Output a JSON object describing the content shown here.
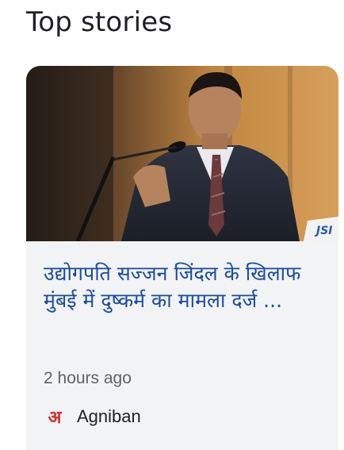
{
  "section": {
    "title": "Top stories"
  },
  "story": {
    "headline": "उद्योगपति सज्जन जिंदल के खिलाफ मुंबई में दुष्कर्म का मामला दर्ज ...",
    "time": "2 hours ago",
    "source": "Agniban",
    "source_logo_text": "अ",
    "image_badge_text": "JSI"
  },
  "colors": {
    "headline": "#1a4ba0",
    "card_background": "#f1f3f4",
    "meta_text": "#5f6368",
    "source_logo": "#d32f2f"
  },
  "icons": {
    "source_logo": "agniban-logo-icon"
  }
}
